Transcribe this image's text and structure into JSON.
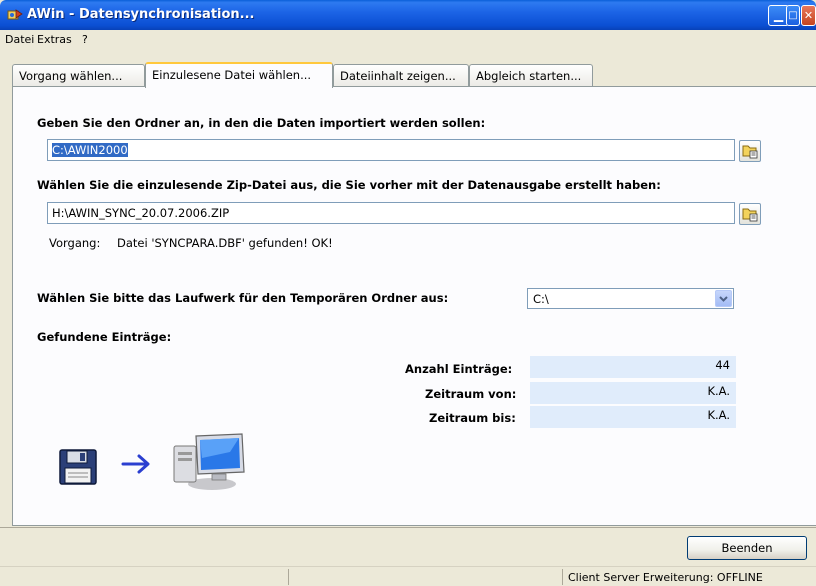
{
  "window": {
    "title": "AWin - Datensynchronisation..."
  },
  "menu": {
    "items": [
      "Datei",
      "Extras",
      "?"
    ]
  },
  "tabs": [
    {
      "label": "Vorgang wählen..."
    },
    {
      "label": "Einzulesene Datei wählen..."
    },
    {
      "label": "Dateiinhalt zeigen..."
    },
    {
      "label": "Abgleich starten..."
    }
  ],
  "form": {
    "folder_label": "Geben Sie den Ordner an, in den die Daten importiert werden sollen:",
    "folder_value": "C:\\AWIN2000",
    "zip_label": "Wählen Sie die einzulesende Zip-Datei aus, die Sie vorher mit der Datenausgabe erstellt haben:",
    "zip_value": "H:\\AWIN_SYNC_20.07.2006.ZIP",
    "status_prefix": "Vorgang:",
    "status_text": "Datei 'SYNCPARA.DBF' gefunden! OK!",
    "drive_label": "Wählen Sie bitte das Laufwerk für den Temporären Ordner aus:",
    "drive_value": "C:\\",
    "found_heading": "Gefundene Einträge:",
    "count_label": "Anzahl Einträge:",
    "count_value": "44",
    "from_label": "Zeitraum von:",
    "from_value": "K.A.",
    "to_label": "Zeitraum bis:",
    "to_value": "K.A."
  },
  "buttons": {
    "close_label": "Beenden"
  },
  "statusbar": {
    "right_text": "Client Server Erweiterung: OFFLINE"
  },
  "colors": {
    "titlebar": "#0b4fd3",
    "selection": "#316ac5",
    "field_bg": "#e0ecfb",
    "tab_highlight": "#ffc83c"
  },
  "icons": [
    "app-icon",
    "minimize-icon",
    "maximize-icon",
    "close-icon",
    "folder-browse-icon",
    "chevron-down-icon",
    "floppy-disk-icon",
    "arrow-right-icon",
    "computer-icon"
  ]
}
